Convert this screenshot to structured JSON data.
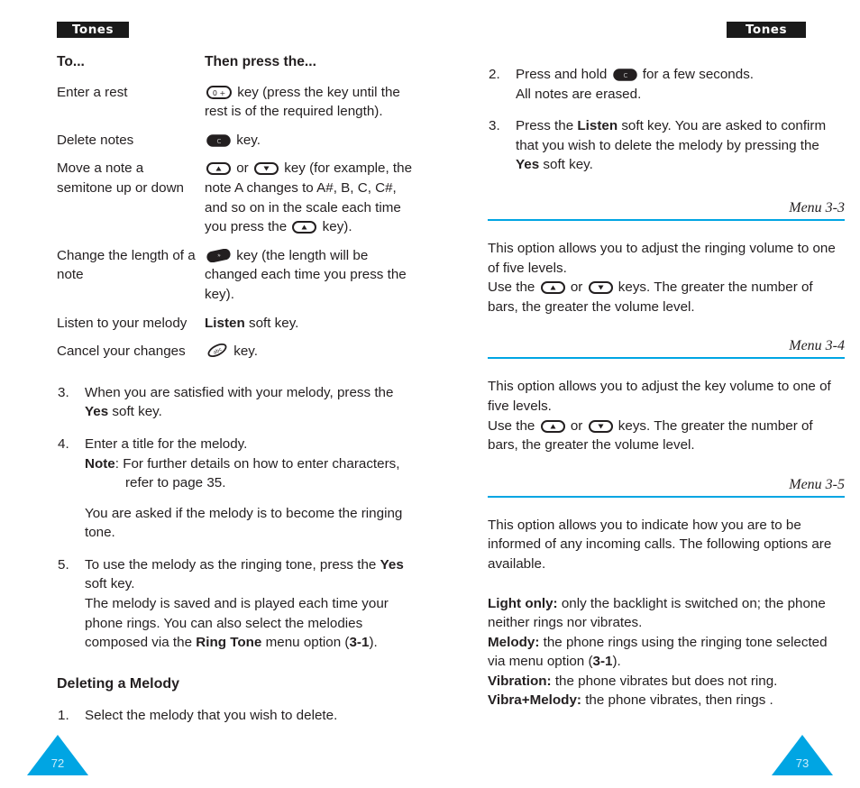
{
  "header": {
    "tab_left": "Tones",
    "tab_right": "Tones"
  },
  "accent_color": "#00a5e3",
  "text_color": "#231f20",
  "left_column": {
    "table": {
      "header": {
        "col1": "To...",
        "col2": "Then press the..."
      },
      "rows": [
        {
          "action": "Enter a rest",
          "keys": [
            "key-zero-plus"
          ],
          "instruction": "key (press the key until the rest is of the required length)."
        },
        {
          "action": "Delete notes",
          "keys": [
            "key-clear"
          ],
          "instruction": "key."
        },
        {
          "action": "Move a note a semitone up or down",
          "keys": [
            "key-up",
            "key-down"
          ],
          "instruction_a": "or",
          "instruction": "key (for example, the note A changes to A#, B, C, C#, and so on in the scale each time you press the",
          "instruction_tail": "key)."
        },
        {
          "action": "Change the length of a note",
          "keys": [
            "key-star"
          ],
          "instruction": "key (the length will be changed each time you press the key)."
        },
        {
          "action": "Listen to your melody",
          "softkey": "Listen",
          "instruction": "soft key."
        },
        {
          "action": "Cancel your changes",
          "keys": [
            "key-cancel"
          ],
          "instruction": "key."
        }
      ]
    },
    "steps": [
      {
        "num": "3.",
        "text_before": "When you are satisfied with your melody, press the ",
        "bold": "Yes",
        "text_after": " soft key."
      },
      {
        "num": "4.",
        "text_before": "Enter a title for the melody.",
        "note_label": "Note",
        "note_text": ": For further details on how to enter characters,",
        "note_text2": "refer to page 35.",
        "extra": "You are asked if the melody is to become the ringing tone."
      },
      {
        "num": "5.",
        "line1_a": "To use the melody as the ringing tone, press the ",
        "line1_bold": "Yes",
        "line1_b": " soft key.",
        "line2_a": "The melody is saved and is played each time your phone rings. You can also select the melodies composed via the ",
        "line2_bold": "Ring Tone",
        "line2_b": " menu option (",
        "line2_bold2": "3-1",
        "line2_c": ")."
      }
    ],
    "sub_head": "Deleting a Melody",
    "delete_steps": [
      {
        "num": "1.",
        "text": "Select the melody that you wish to delete."
      }
    ]
  },
  "right_column": {
    "steps": [
      {
        "num": "2.",
        "text_a": "Press and hold ",
        "key": "key-clear",
        "text_b": " for a few seconds.",
        "text_c": "All notes are erased."
      },
      {
        "num": "3.",
        "text_a": "Press the ",
        "bold": "Listen",
        "text_b": " soft key. You are asked to confirm that you wish to delete the melody by pressing the ",
        "bold2": "Yes",
        "text_c": " soft key."
      }
    ],
    "sections": [
      {
        "menu_ref": "Menu 3-3",
        "paragraph": "This option allows you to adjust the ringing volume to one of five levels.",
        "use_prefix": "Use the",
        "keys": [
          "key-up",
          "key-down"
        ],
        "use_or": "or",
        "use_suffix": "keys. The greater the number of bars, the greater the volume level."
      },
      {
        "menu_ref": "Menu 3-4",
        "paragraph": "This option allows you to adjust the key volume to one of five levels.",
        "use_prefix": "Use the",
        "keys": [
          "key-up",
          "key-down"
        ],
        "use_or": "or",
        "use_suffix": "keys. The greater the number of bars, the greater the volume level."
      },
      {
        "menu_ref": "Menu 3-5",
        "paragraph": "This option allows you to indicate how you are to be informed of any incoming calls. The following options are available.",
        "options": [
          {
            "label": "Light only:",
            "text": " only the backlight is switched on; the phone neither rings nor vibrates."
          },
          {
            "label": "Melody:",
            "text": " the phone rings using the ringing tone selected via menu option (",
            "bold_ref": "3-1",
            "text_tail": ")."
          },
          {
            "label": "Vibration:",
            "text": " the phone vibrates but does not ring."
          },
          {
            "label": "Vibra+Melody:",
            "text": " the phone vibrates, then rings ."
          }
        ]
      }
    ]
  },
  "page_numbers": {
    "left": "72",
    "right": "73"
  }
}
